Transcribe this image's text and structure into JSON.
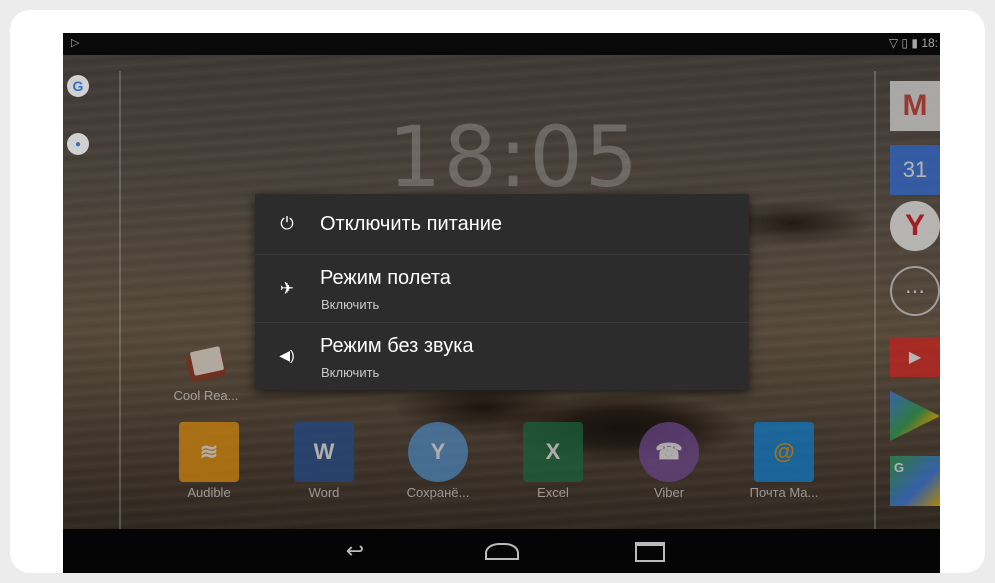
{
  "statusbar": {
    "play_icon": "play-icon",
    "wifi_icon": "wifi-icon",
    "battery_icon": "battery-icon",
    "time": "18:"
  },
  "sidebar_left": [
    {
      "icon": "google-icon",
      "glyph": "G",
      "color": "#4285F4"
    },
    {
      "icon": "microphone-icon",
      "glyph": "●",
      "color": "#4285F4"
    }
  ],
  "clock": {
    "time": "18:05"
  },
  "power_menu": {
    "items": [
      {
        "icon": "power-icon",
        "glyph": "⏻",
        "title": "Отключить питание",
        "subtitle": ""
      },
      {
        "icon": "airplane-icon",
        "glyph": "✈",
        "title": "Режим полета",
        "subtitle": "Включить"
      },
      {
        "icon": "volume-icon",
        "glyph": "🔈",
        "title": "Режим без звука",
        "subtitle": "Включить"
      }
    ]
  },
  "home_shortcut": {
    "label": "Cool Rea..."
  },
  "dock": [
    {
      "label": "Audible",
      "icon": "audible-icon",
      "color": "#f39c12",
      "glyph": "≋"
    },
    {
      "label": "Word",
      "icon": "word-icon",
      "color": "#2b579a",
      "glyph": "W"
    },
    {
      "label": "Сохранё...",
      "icon": "yandex-saved-icon",
      "color": "#5a9ad5",
      "glyph": "Y"
    },
    {
      "label": "Excel",
      "icon": "excel-icon",
      "color": "#217346",
      "glyph": "X"
    },
    {
      "label": "Viber",
      "icon": "viber-icon",
      "color": "#7b519d",
      "glyph": "☎"
    },
    {
      "label": "Почта Ма...",
      "icon": "mail-ru-icon",
      "color": "#168de2",
      "glyph": "@"
    }
  ],
  "right_column": [
    {
      "icon": "gmail-icon",
      "glyph": "M",
      "color": "#d44638"
    },
    {
      "icon": "calendar-icon",
      "glyph": "31",
      "color": "#3b78e7"
    },
    {
      "icon": "yandex-browser-icon",
      "glyph": "Y",
      "color": "#e31b23"
    },
    {
      "icon": "app-drawer-icon",
      "glyph": "⋯",
      "color": "#888888"
    },
    {
      "icon": "youtube-icon",
      "glyph": "▶",
      "color": "#e52d27"
    },
    {
      "icon": "play-store-icon",
      "glyph": "▶",
      "color": "#34a853"
    },
    {
      "icon": "google-maps-icon",
      "glyph": "G",
      "color": "#4caf50"
    }
  ],
  "navbar": {
    "back": "↩",
    "home": "⌂",
    "recents": "▭"
  }
}
